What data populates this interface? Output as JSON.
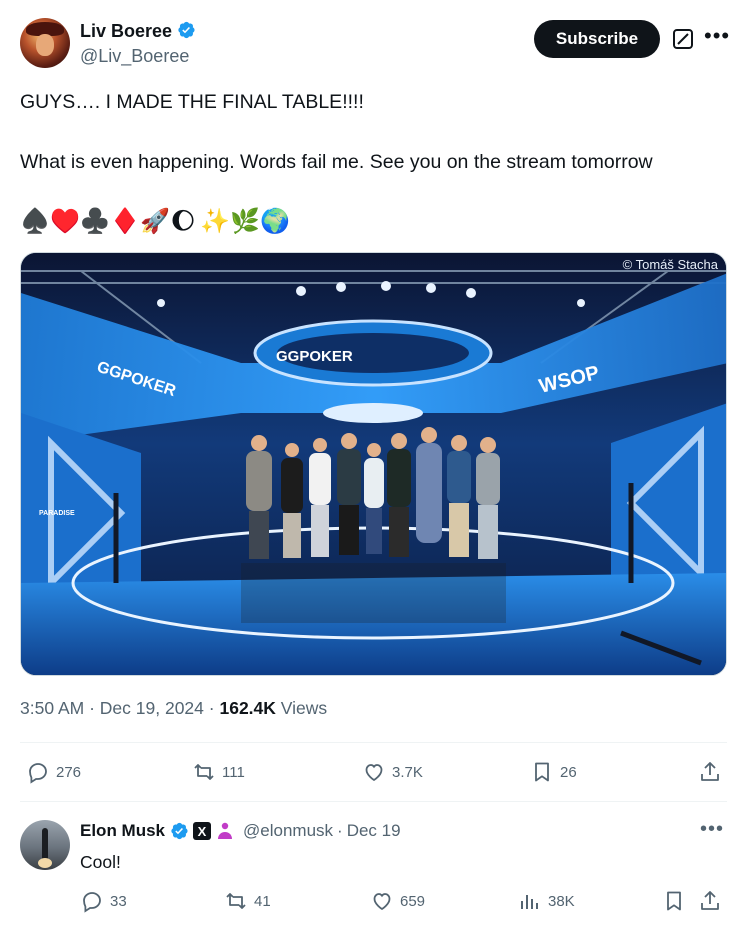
{
  "author": {
    "display_name": "Liv Boeree",
    "handle": "@Liv_Boeree",
    "verified": true
  },
  "header_actions": {
    "subscribe_label": "Subscribe",
    "grok_icon": "grok-icon",
    "more_icon": "more-icon"
  },
  "tweet": {
    "line1": "GUYS…. I MADE THE FINAL TABLE!!!!",
    "line2": "What is even happening. Words fail me. See you on the stream tomorrow",
    "emojis": [
      "♠️",
      "♥️",
      "♣️",
      "♦️",
      "🚀",
      "🌔",
      "✨",
      "🌿",
      "🌍"
    ],
    "photo_credit": "© Tomáš Stacha",
    "photo_text": {
      "gg_poker_ring": "GGPOKER",
      "gg_poker_left": "GGPOKER",
      "wsop": "WSOP",
      "paradise": "PARADISE"
    }
  },
  "meta": {
    "time": "3:50 AM",
    "separator": "·",
    "date": "Dec 19, 2024",
    "views_count": "162.4K",
    "views_label": "Views"
  },
  "actions": {
    "replies": "276",
    "reposts": "111",
    "likes": "3.7K",
    "bookmarks": "26"
  },
  "reply": {
    "display_name": "Elon Musk",
    "handle": "@elonmusk",
    "separator": "·",
    "date": "Dec 19",
    "text": "Cool!",
    "badge_x": "X",
    "actions": {
      "replies": "33",
      "reposts": "41",
      "likes": "659",
      "views": "38K"
    }
  },
  "colors": {
    "text_primary": "#0f1419",
    "text_secondary": "#536471",
    "verified_blue": "#1d9bf0",
    "divider": "#eff3f4",
    "subscribe_bg": "#0f1419",
    "stage_blue": "#1a7ad4"
  }
}
